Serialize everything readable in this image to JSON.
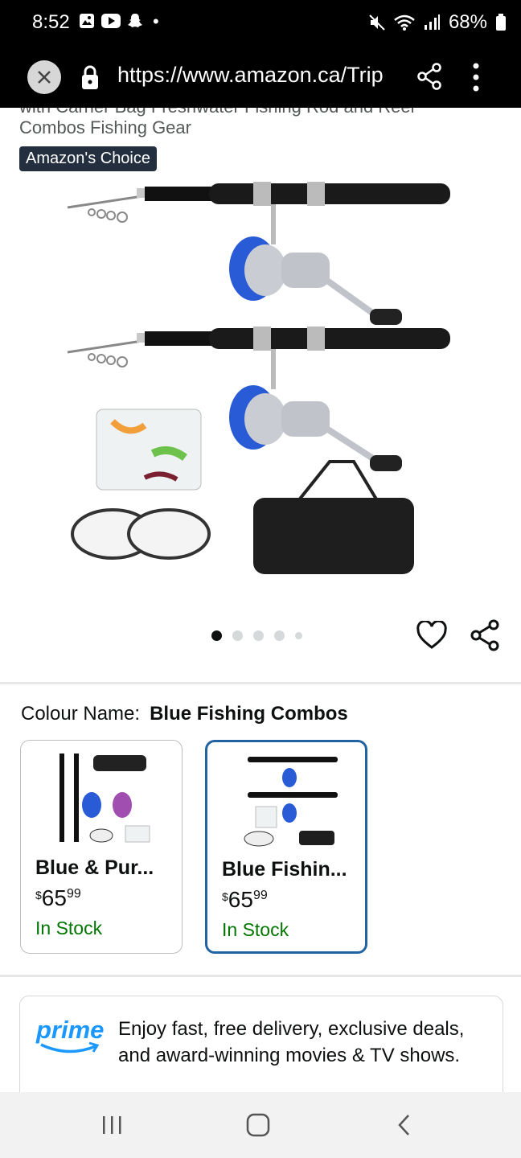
{
  "status_bar": {
    "time": "8:52",
    "battery": "68%",
    "icons_left": [
      "gallery-icon",
      "youtube-icon",
      "snapchat-icon"
    ],
    "icons_right": [
      "mute-icon",
      "wifi-icon",
      "signal-icon",
      "battery-icon"
    ]
  },
  "browser": {
    "url": "https://www.amazon.ca/Trip"
  },
  "product": {
    "title_line1_partial": "with Carrier Bag Freshwater Fishing Rod and Reel",
    "title_line2": "Combos Fishing Gear",
    "badge": "Amazon's Choice",
    "image_count": 5,
    "active_image_index": 0
  },
  "colour": {
    "label": "Colour Name:",
    "selected": "Blue Fishing Combos",
    "options": [
      {
        "name": "Blue & Pur...",
        "currency": "$",
        "price_whole": "65",
        "price_cents": "99",
        "stock": "In Stock",
        "selected": false
      },
      {
        "name": "Blue Fishin...",
        "currency": "$",
        "price_whole": "65",
        "price_cents": "99",
        "stock": "In Stock",
        "selected": true
      }
    ]
  },
  "prime": {
    "logo": "prime",
    "text": "Enjoy fast, free delivery, exclusive deals, and award-winning movies & TV shows."
  },
  "colors": {
    "badge_bg": "#232f3e",
    "selected_border": "#2162a1",
    "in_stock": "#007600",
    "prime_blue": "#1a98ff"
  }
}
